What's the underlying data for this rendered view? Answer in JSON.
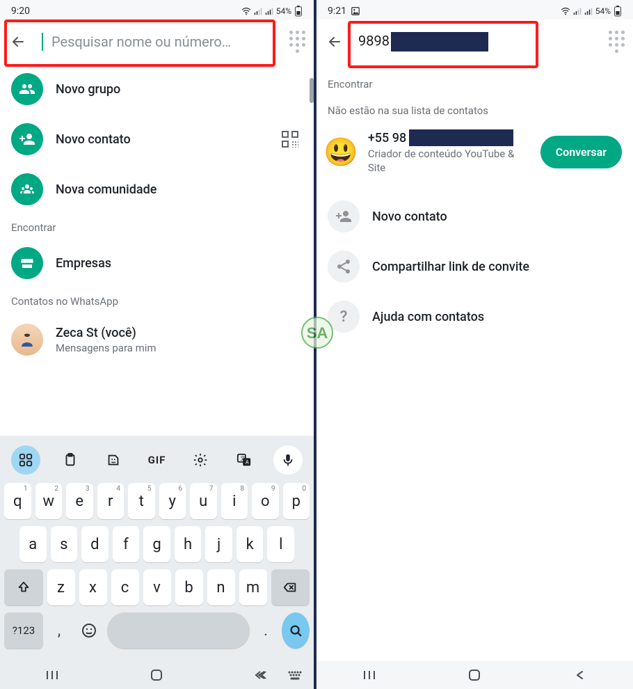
{
  "left": {
    "status_time": "9:20",
    "battery": "54%",
    "search_placeholder": "Pesquisar nome ou número…",
    "rows": {
      "new_group": "Novo grupo",
      "new_contact": "Novo contato",
      "new_community": "Nova comunidade",
      "businesses": "Empresas",
      "self_name": "Zeca St (você)",
      "self_sub": "Mensagens para mim"
    },
    "sections": {
      "find": "Encontrar",
      "contacts": "Contatos no WhatsApp"
    }
  },
  "right": {
    "status_time": "9:21",
    "battery": "54%",
    "search_value": "9898",
    "sections": {
      "find": "Encontrar",
      "not_in_list": "Não estão na sua lista de contatos"
    },
    "result": {
      "phone_prefix": "+55 98",
      "desc": "Criador de conteúdo YouTube & Site",
      "chat_btn": "Conversar"
    },
    "rows": {
      "new_contact": "Novo contato",
      "share_invite": "Compartilhar link de convite",
      "help_contacts": "Ajuda com contatos"
    }
  },
  "keyboard": {
    "gif": "GIF",
    "sym": "?123",
    "row1": [
      "q",
      "w",
      "e",
      "r",
      "t",
      "y",
      "u",
      "i",
      "o",
      "p"
    ],
    "row1_sup": [
      "1",
      "2",
      "3",
      "4",
      "5",
      "6",
      "7",
      "8",
      "9",
      "0"
    ],
    "row2": [
      "a",
      "s",
      "d",
      "f",
      "g",
      "h",
      "j",
      "k",
      "l"
    ],
    "row3": [
      "z",
      "x",
      "c",
      "v",
      "b",
      "n",
      "m"
    ]
  },
  "watermark_text": "SA"
}
